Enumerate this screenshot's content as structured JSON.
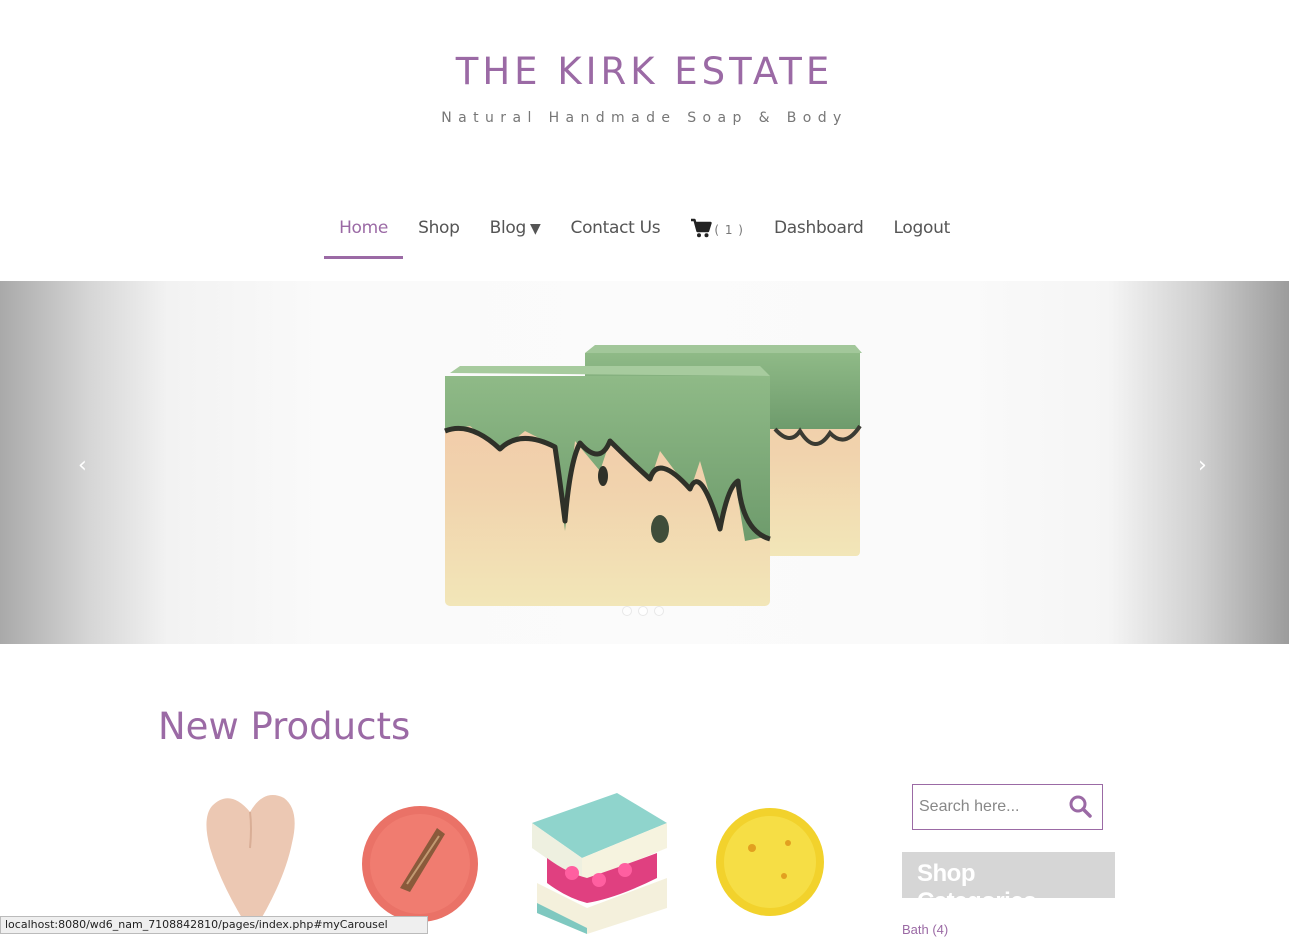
{
  "brand": {
    "title": "THE KIRK ESTATE",
    "tagline": "Natural Handmade Soap & Body"
  },
  "nav": {
    "items": [
      {
        "label": "Home",
        "active": true
      },
      {
        "label": "Shop"
      },
      {
        "label": "Blog",
        "caret": "▼"
      },
      {
        "label": "Contact Us"
      },
      {
        "label": "Dashboard"
      },
      {
        "label": "Logout"
      }
    ],
    "cart_count": "( 1 )"
  },
  "carousel": {
    "prev_glyph": "‹",
    "next_glyph": "›",
    "slides": 3,
    "active_slide": 1
  },
  "main": {
    "section_title": "New Products",
    "products": [
      {
        "icon": "heart-soap-image"
      },
      {
        "icon": "red-round-soap-image"
      },
      {
        "icon": "layered-soap-image"
      },
      {
        "icon": "yellow-round-soap-image"
      }
    ]
  },
  "sidebar": {
    "search_placeholder": "Search here...",
    "categories_heading": "Shop Categories",
    "categories": [
      {
        "label": "Bath (4)"
      }
    ]
  },
  "status_bar": {
    "url": "localhost:8080/wd6_nam_7108842810/pages/index.php#myCarousel"
  },
  "colors": {
    "accent": "#9b6aa5",
    "category_heading_bg": "#d6d6d6"
  }
}
